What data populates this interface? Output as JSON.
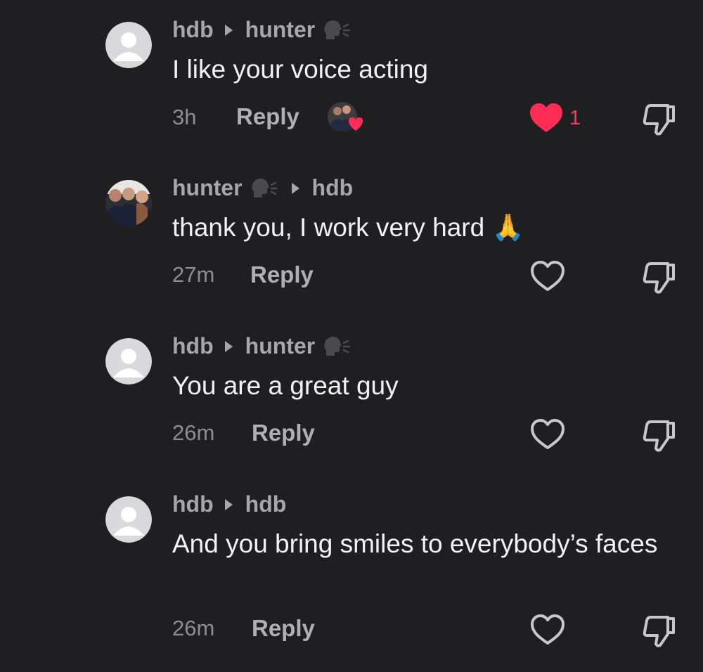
{
  "colors": {
    "background": "#1f1f21",
    "username": "#a7a7a9",
    "text": "#f2f2f2",
    "timestamp": "#8e8e90",
    "like_active": "#ff3b5c"
  },
  "comments": [
    {
      "author": "hdb",
      "reply_to": "hunter",
      "reply_to_icon": "speaking-head-icon",
      "text": "I like your voice acting",
      "time": "3h",
      "reply_label": "Reply",
      "liked_by_creator": true,
      "liked": true,
      "like_count": "1",
      "avatar": "default-avatar-icon"
    },
    {
      "author": "hunter",
      "author_icon": "speaking-head-icon",
      "reply_to": "hdb",
      "text": "thank you, I work very hard 🙏",
      "time": "27m",
      "reply_label": "Reply",
      "liked": false,
      "avatar": "photo-avatar"
    },
    {
      "author": "hdb",
      "reply_to": "hunter",
      "reply_to_icon": "speaking-head-icon",
      "text": "You are a great guy",
      "time": "26m",
      "reply_label": "Reply",
      "liked": false,
      "avatar": "default-avatar-icon"
    },
    {
      "author": "hdb",
      "reply_to": "hdb",
      "text": "And you bring smiles to everybody’s faces",
      "time": "26m",
      "reply_label": "Reply",
      "liked": false,
      "avatar": "default-avatar-icon"
    }
  ]
}
